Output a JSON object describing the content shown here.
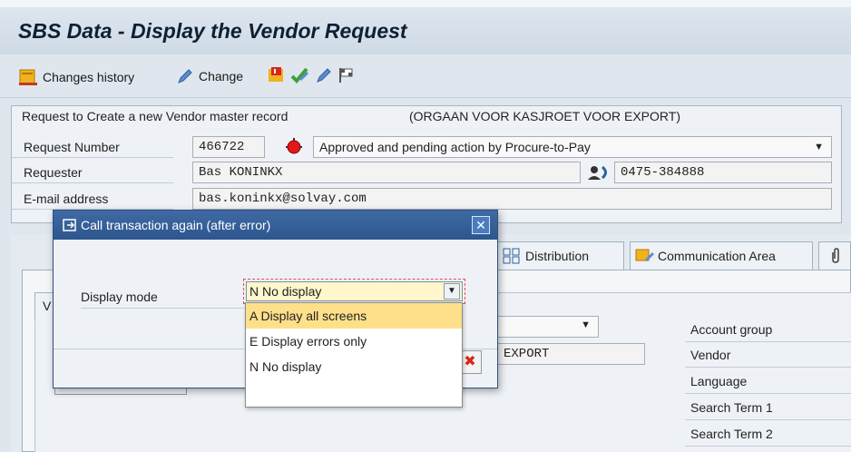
{
  "window": {
    "title": "SBS Data - Display the Vendor Request"
  },
  "toolbar": {
    "changes_history": "Changes history",
    "change": "Change"
  },
  "header": {
    "request_text": "Request to Create a new Vendor master record",
    "org_text": "(ORGAAN VOOR KASJROET VOOR EXPORT)",
    "request_number_label": "Request Number",
    "request_number": "466722",
    "status": "Approved and pending action by Procure-to-Pay",
    "requester_label": "Requester",
    "requester": "Bas KONINKX",
    "phone": "0475-384888",
    "email_label": "E-mail address",
    "email": "bas.koninkx@solvay.com"
  },
  "tabs": {
    "distribution": "Distribution",
    "communication": "Communication Area"
  },
  "inner": {
    "left_letter": "V",
    "name_fragment": "EXPORT"
  },
  "right_labels": [
    "Account group",
    "Vendor",
    "Language",
    "Search Term 1",
    "Search Term 2"
  ],
  "dialog": {
    "title": "Call transaction again (after error)",
    "display_mode_label": "Display mode",
    "selected": "N No display",
    "options": [
      "A Display all screens",
      "E Display errors only",
      "N No display"
    ]
  },
  "colors": {
    "title_bar": "#2d568f",
    "highlight": "#ffe08a",
    "status_red": "#e0181b"
  }
}
